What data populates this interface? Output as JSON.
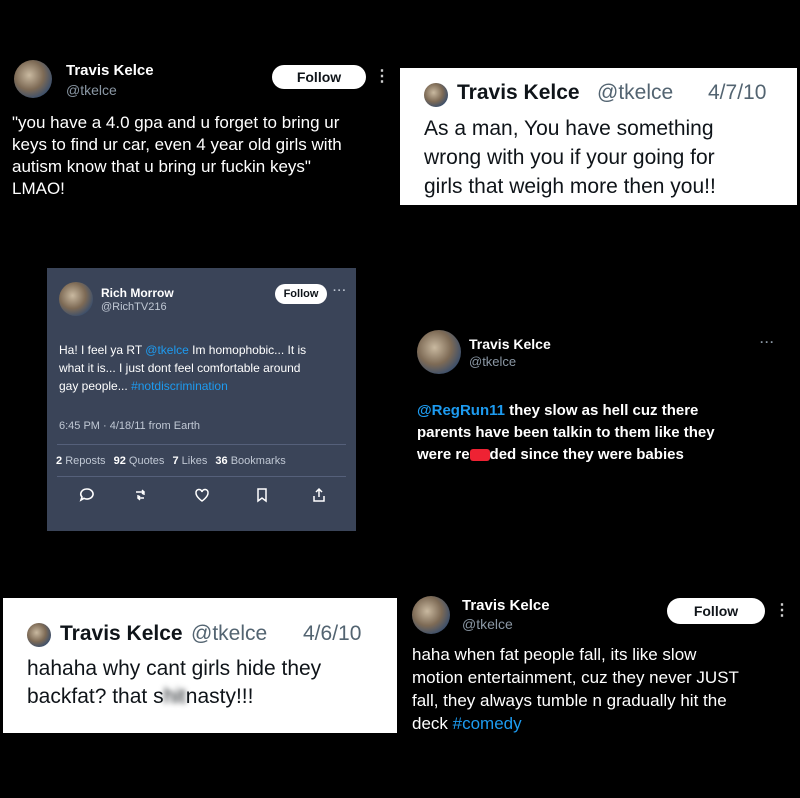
{
  "panel1": {
    "name": "Travis Kelce",
    "handle": "@tkelce",
    "follow_label": "Follow",
    "more": "⋮",
    "text": "\"you have a 4.0 gpa and u forget to bring ur\nkeys to find ur car, even 4 year old girls with\nautism know that u bring ur fuckin keys\"\nLMAO!"
  },
  "panel2": {
    "name": "Travis Kelce",
    "handle": "@tkelce",
    "date": "4/7/10",
    "text": "As a man, You have something\nwrong with you if your going for\ngirls that weigh more then you!!"
  },
  "panel3": {
    "name": "Rich Morrow",
    "handle": "@RichTV216",
    "follow_label": "Follow",
    "more": "···",
    "text_part1": "Ha! I feel ya RT ",
    "mention": "@tkelce",
    "text_part2": " Im homophobic... It is\nwhat it is... I just dont feel comfortable around\ngay people... ",
    "hashtag": "#notdiscrimination",
    "meta": "6:45 PM · 4/18/11 from Earth",
    "stats": [
      {
        "count": "2",
        "label": "Reposts"
      },
      {
        "count": "92",
        "label": "Quotes"
      },
      {
        "count": "7",
        "label": "Likes"
      },
      {
        "count": "36",
        "label": "Bookmarks"
      }
    ]
  },
  "panel4": {
    "name": "Travis Kelce",
    "handle": "@tkelce",
    "more": "···",
    "mention": "@RegRun11",
    "text_part1": " they slow as hell cuz there\nparents have been talkin to them like they\nwere re",
    "text_part2": "ded since they were babies"
  },
  "panel5": {
    "name": "Travis Kelce",
    "handle": "@tkelce",
    "date": "4/6/10",
    "text_part1": "hahaha why cant girls hide they\nbackfat? that s",
    "text_blurred": "hit",
    "text_part2": "nasty!!!"
  },
  "panel6": {
    "name": "Travis Kelce",
    "handle": "@tkelce",
    "follow_label": "Follow",
    "more": "⋮",
    "text": "haha when fat people fall, its like slow\nmotion entertainment, cuz they never JUST\nfall, they always tumble n gradually hit the\ndeck ",
    "hashtag": "#comedy"
  },
  "colors": {
    "link": "#1d9bf0",
    "dim_panel": "#3a4458",
    "redaction": "#e22233"
  }
}
